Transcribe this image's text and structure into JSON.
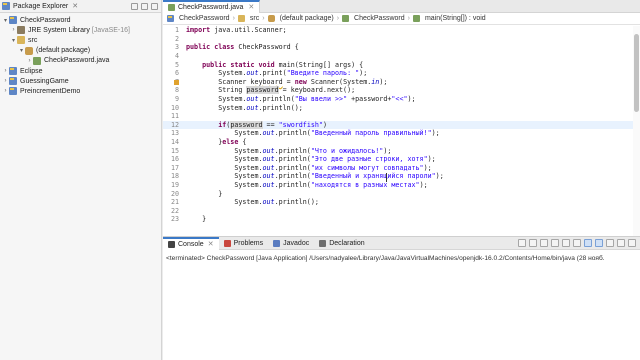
{
  "explorer": {
    "title": "Package Explorer",
    "items": [
      {
        "label": "CheckPassword",
        "arrow": "▾"
      },
      {
        "label": "JRE System Library",
        "suffix": "[JavaSE-16]",
        "arrow": "›"
      },
      {
        "label": "src",
        "arrow": "▾"
      },
      {
        "label": "(default package)",
        "arrow": "▾"
      },
      {
        "label": "CheckPassword.java",
        "arrow": "›"
      },
      {
        "label": "Eclipse",
        "arrow": "›"
      },
      {
        "label": "GuessingGame",
        "arrow": "›"
      },
      {
        "label": "PreincrementDemo",
        "arrow": "›"
      }
    ]
  },
  "editor": {
    "tab_label": "CheckPassword.java",
    "breadcrumb": [
      "CheckPassword",
      "src",
      "(default package)",
      "CheckPassword",
      "main(String[]) : void"
    ],
    "lines": [
      {
        "n": "1",
        "segs": [
          {
            "t": "import",
            "c": "kw"
          },
          {
            "t": " java.util.Scanner;"
          }
        ]
      },
      {
        "n": "2",
        "segs": [
          {
            "t": ""
          }
        ]
      },
      {
        "n": "3",
        "segs": [
          {
            "t": "public",
            "c": "kw"
          },
          {
            "t": " "
          },
          {
            "t": "class",
            "c": "kw"
          },
          {
            "t": " CheckPassword {"
          }
        ]
      },
      {
        "n": "4",
        "segs": [
          {
            "t": ""
          }
        ]
      },
      {
        "n": "5",
        "segs": [
          {
            "t": "    "
          },
          {
            "t": "public",
            "c": "kw"
          },
          {
            "t": " "
          },
          {
            "t": "static",
            "c": "kw"
          },
          {
            "t": " "
          },
          {
            "t": "void",
            "c": "kw"
          },
          {
            "t": " main(String[] args) {"
          }
        ]
      },
      {
        "n": "6",
        "segs": [
          {
            "t": "        System."
          },
          {
            "t": "out",
            "c": "sf"
          },
          {
            "t": ".print("
          },
          {
            "t": "\"Введите пароль: \"",
            "c": "st"
          },
          {
            "t": ");"
          }
        ]
      },
      {
        "n": "7",
        "segs": [
          {
            "t": "        Scanner "
          },
          {
            "t": "keyboard",
            "c": "warn"
          },
          {
            "t": " = "
          },
          {
            "t": "new",
            "c": "kw"
          },
          {
            "t": " Scanner(System."
          },
          {
            "t": "in",
            "c": "sf"
          },
          {
            "t": ");"
          }
        ]
      },
      {
        "n": "8",
        "segs": [
          {
            "t": "        String "
          },
          {
            "t": "password",
            "c": "occ"
          },
          {
            "t": " = keyboard.next();"
          }
        ]
      },
      {
        "n": "9",
        "segs": [
          {
            "t": "        System."
          },
          {
            "t": "out",
            "c": "sf"
          },
          {
            "t": ".println("
          },
          {
            "t": "\"Вы ввели >>\"",
            "c": "st"
          },
          {
            "t": " +password+"
          },
          {
            "t": "\"<<\"",
            "c": "st"
          },
          {
            "t": ");"
          }
        ]
      },
      {
        "n": "10",
        "segs": [
          {
            "t": "        System."
          },
          {
            "t": "out",
            "c": "sf"
          },
          {
            "t": ".println();"
          }
        ]
      },
      {
        "n": "11",
        "segs": [
          {
            "t": ""
          }
        ]
      },
      {
        "n": "12",
        "hl": true,
        "segs": [
          {
            "t": "        "
          },
          {
            "t": "if",
            "c": "kw"
          },
          {
            "t": "("
          },
          {
            "t": "password",
            "c": "occ"
          },
          {
            "t": " == "
          },
          {
            "t": "\"swordfish\"",
            "c": "st"
          },
          {
            "t": ")"
          }
        ]
      },
      {
        "n": "13",
        "segs": [
          {
            "t": "            System."
          },
          {
            "t": "out",
            "c": "sf"
          },
          {
            "t": ".println("
          },
          {
            "t": "\"Введенный пароль правильный!\"",
            "c": "st"
          },
          {
            "t": ");"
          }
        ]
      },
      {
        "n": "14",
        "segs": [
          {
            "t": "        }"
          },
          {
            "t": "else",
            "c": "kw"
          },
          {
            "t": " {"
          }
        ]
      },
      {
        "n": "15",
        "segs": [
          {
            "t": "            System."
          },
          {
            "t": "out",
            "c": "sf"
          },
          {
            "t": ".println("
          },
          {
            "t": "\"Что и ожидалось!\"",
            "c": "st"
          },
          {
            "t": ");"
          }
        ]
      },
      {
        "n": "16",
        "segs": [
          {
            "t": "            System."
          },
          {
            "t": "out",
            "c": "sf"
          },
          {
            "t": ".println("
          },
          {
            "t": "\"Это две разные строки, хотя\"",
            "c": "st"
          },
          {
            "t": ");"
          }
        ]
      },
      {
        "n": "17",
        "segs": [
          {
            "t": "            System."
          },
          {
            "t": "out",
            "c": "sf"
          },
          {
            "t": ".println("
          },
          {
            "t": "\"их символы могут совпадать\"",
            "c": "st"
          },
          {
            "t": ");"
          }
        ]
      },
      {
        "n": "18",
        "segs": [
          {
            "t": "            System."
          },
          {
            "t": "out",
            "c": "sf"
          },
          {
            "t": ".println("
          },
          {
            "t": "\"Введенный и хранящийся пароли\"",
            "c": "st"
          },
          {
            "t": ");"
          }
        ]
      },
      {
        "n": "19",
        "segs": [
          {
            "t": "            System."
          },
          {
            "t": "out",
            "c": "sf"
          },
          {
            "t": ".println("
          },
          {
            "t": "\"находятся в разных местах\"",
            "c": "st"
          },
          {
            "t": ");"
          }
        ]
      },
      {
        "n": "20",
        "segs": [
          {
            "t": "        }"
          }
        ]
      },
      {
        "n": "21",
        "segs": [
          {
            "t": "            System."
          },
          {
            "t": "out",
            "c": "sf"
          },
          {
            "t": ".println();"
          }
        ]
      },
      {
        "n": "22",
        "segs": [
          {
            "t": ""
          }
        ]
      },
      {
        "n": "23",
        "segs": [
          {
            "t": "    }"
          }
        ]
      }
    ]
  },
  "console": {
    "tabs": [
      "Console",
      "Problems",
      "Javadoc",
      "Declaration"
    ],
    "active_tab": "Console",
    "output": "<terminated> CheckPassword [Java Application] /Users/nadyalee/Library/Java/JavaVirtualMachines/openjdk-16.0.2/Contents/Home/bin/java  (28 нояб."
  },
  "colors": {
    "accent": "#3b79c7",
    "keyword": "#7f0055",
    "string": "#2a00ff",
    "static_field": "#0000c0",
    "highlight_line": "#e8f2fe"
  }
}
